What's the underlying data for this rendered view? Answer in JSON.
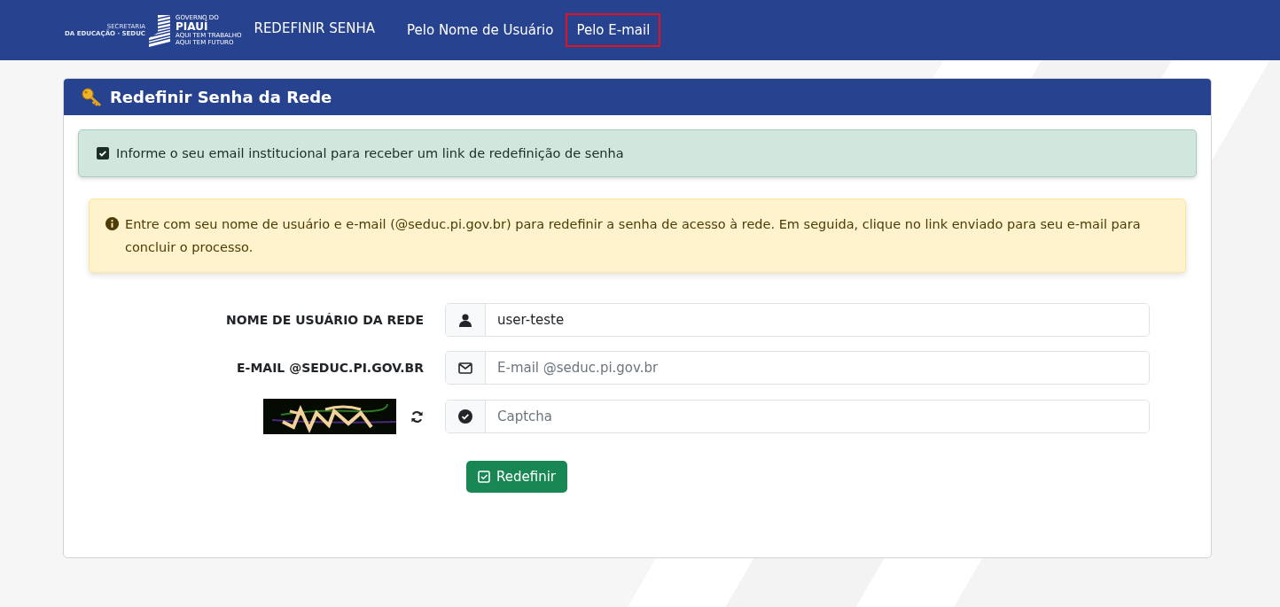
{
  "header": {
    "logo": {
      "secretaria": "SECRETARIA",
      "educacao": "DA EDUCAÇÃO · SEDUC",
      "governo": "GOVERNO DO",
      "piaui": "PIAUÍ",
      "slogan_1": "AQUI TEM TRABALHO",
      "slogan_2": "AQUI TEM FUTURO"
    },
    "title": "REDEFINIR SENHA",
    "tabs": [
      {
        "label": "Pelo Nome de Usuário",
        "selected": false
      },
      {
        "label": "Pelo E-mail",
        "selected": true
      }
    ]
  },
  "card": {
    "title": "Redefinir Senha da Rede",
    "success_alert": "Informe o seu email institucional para receber um link de redefinição de senha",
    "info_alert": "Entre com seu nome de usuário e e-mail (@seduc.pi.gov.br) para redefinir a senha de acesso à rede. Em seguida, clique no link enviado para seu e-mail para concluir o processo.",
    "fields": [
      {
        "kind": "user",
        "label": "NOME DE USUÁRIO DA REDE",
        "value": "user-teste"
      },
      {
        "kind": "email",
        "label": "E-MAIL @SEDUC.PI.GOV.BR",
        "placeholder": "E-mail @seduc.pi.gov.br"
      },
      {
        "kind": "captcha",
        "placeholder": "Captcha"
      }
    ],
    "submit": "Redefinir"
  }
}
